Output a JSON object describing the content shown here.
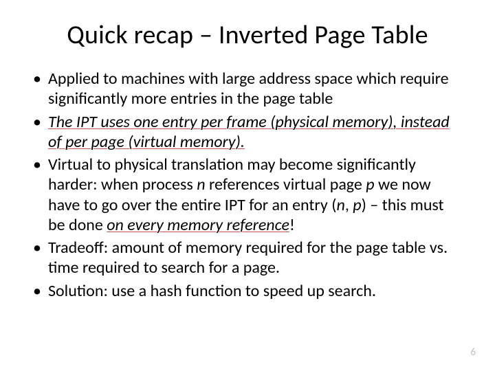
{
  "title": "Quick recap – Inverted Page Table",
  "bullets": {
    "b1": "Applied to machines with large address space which require significantly more entries in the page table",
    "b2a": "The IPT uses one entry per frame (physical memory), instead of per page (virtual memory).",
    "b3a": "Virtual to physical translation may become significantly harder: when process ",
    "b3n": "n",
    "b3b": " references virtual page ",
    "b3p": "p",
    "b3c": " we now have to go over the entire IPT for an entry (",
    "b3d": ", ",
    "b3e": ") – this must be done ",
    "b3f": "on every memory reference",
    "b3g": "!",
    "b4": "Tradeoff: amount of memory required for the page table vs. time required to search for a page.",
    "b5": "Solution: use a hash function to speed up search."
  },
  "page_number": "6"
}
